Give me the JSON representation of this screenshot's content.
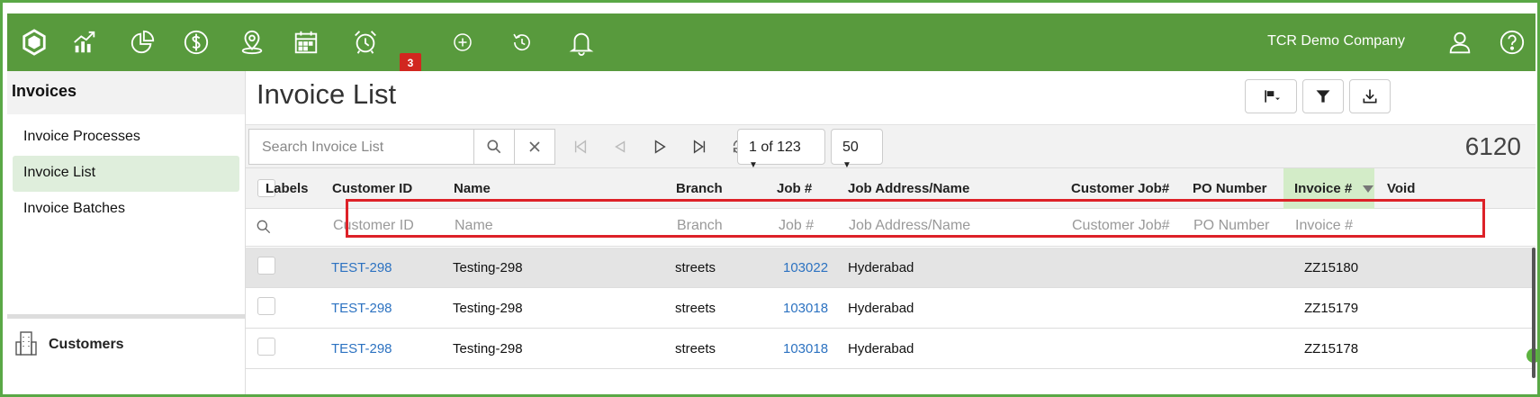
{
  "topbar": {
    "company": "TCR Demo Company",
    "alarm_badge": "3",
    "icons": [
      "logo-hexagon-icon",
      "chart-up-icon",
      "pie-chart-icon",
      "dollar-icon",
      "map-pin-icon",
      "calendar-icon",
      "alarm-clock-icon",
      "plus-circle-icon",
      "history-icon",
      "bell-icon",
      "user-icon",
      "help-icon"
    ]
  },
  "sidebar": {
    "header": "Invoices",
    "items": [
      {
        "label": "Invoice Processes"
      },
      {
        "label": "Invoice List"
      },
      {
        "label": "Invoice Batches"
      }
    ],
    "customers": "Customers"
  },
  "main": {
    "title": "Invoice List",
    "search_placeholder": "Search Invoice List",
    "page": "1 of 123",
    "page_size": "50",
    "total": "6120"
  },
  "table": {
    "headers": {
      "labels": "Labels",
      "customer_id": "Customer ID",
      "name": "Name",
      "branch": "Branch",
      "job": "Job #",
      "job_address": "Job Address/Name",
      "customer_job": "Customer Job#",
      "po_number": "PO Number",
      "invoice": "Invoice #",
      "void": "Void"
    },
    "filters": {
      "customer_id": "Customer ID",
      "name": "Name",
      "branch": "Branch",
      "job": "Job #",
      "job_address": "Job Address/Name",
      "customer_job": "Customer Job#",
      "po_number": "PO Number",
      "invoice": "Invoice #"
    },
    "rows": [
      {
        "customer_id": "TEST-298",
        "name": "Testing-298",
        "branch": "streets",
        "job": "103022",
        "job_address": "Hyderabad",
        "invoice": "ZZ15180"
      },
      {
        "customer_id": "TEST-298",
        "name": "Testing-298",
        "branch": "streets",
        "job": "103018",
        "job_address": "Hyderabad",
        "invoice": "ZZ15179"
      },
      {
        "customer_id": "TEST-298",
        "name": "Testing-298",
        "branch": "streets",
        "job": "103018",
        "job_address": "Hyderabad",
        "invoice": "ZZ15178"
      }
    ]
  },
  "colors": {
    "topbar": "#589a3d",
    "highlight_box": "#dd2128",
    "link": "#2c72c1",
    "active_nav": "#dfeedc"
  }
}
